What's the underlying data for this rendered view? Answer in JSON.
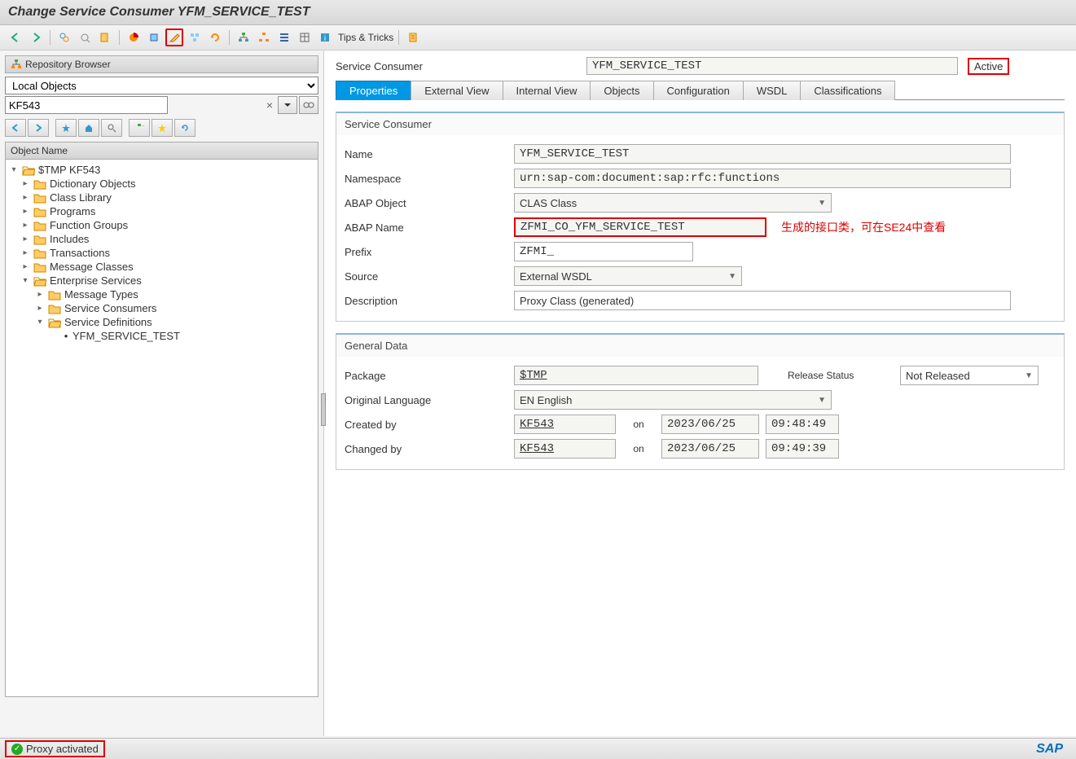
{
  "title": "Change Service Consumer YFM_SERVICE_TEST",
  "toolbar": {
    "tips_tricks": "Tips & Tricks"
  },
  "sidebar": {
    "browser_title": "Repository Browser",
    "scope": "Local Objects",
    "user": "KF543",
    "tree_header": "Object Name",
    "items": [
      {
        "label": "$TMP KF543",
        "open": true,
        "indent": 0,
        "toggle": "▾"
      },
      {
        "label": "Dictionary Objects",
        "indent": 1,
        "toggle": "▸"
      },
      {
        "label": "Class Library",
        "indent": 1,
        "toggle": "▸"
      },
      {
        "label": "Programs",
        "indent": 1,
        "toggle": "▸"
      },
      {
        "label": "Function Groups",
        "indent": 1,
        "toggle": "▸"
      },
      {
        "label": "Includes",
        "indent": 1,
        "toggle": "▸"
      },
      {
        "label": "Transactions",
        "indent": 1,
        "toggle": "▸"
      },
      {
        "label": "Message Classes",
        "indent": 1,
        "toggle": "▸"
      },
      {
        "label": "Enterprise Services",
        "open": true,
        "indent": 1,
        "toggle": "▾"
      },
      {
        "label": "Message Types",
        "indent": 2,
        "toggle": "▸"
      },
      {
        "label": "Service Consumers",
        "indent": 2,
        "toggle": "▸"
      },
      {
        "label": "Service Definitions",
        "open": true,
        "indent": 2,
        "toggle": "▾"
      },
      {
        "label": "YFM_SERVICE_TEST",
        "indent": 3,
        "leaf": true
      }
    ]
  },
  "header": {
    "label": "Service Consumer",
    "value": "YFM_SERVICE_TEST",
    "status": "Active"
  },
  "tabs": [
    "Properties",
    "External View",
    "Internal View",
    "Objects",
    "Configuration",
    "WSDL",
    "Classifications"
  ],
  "active_tab": 0,
  "group1": {
    "title": "Service Consumer",
    "name_label": "Name",
    "name_value": "YFM_SERVICE_TEST",
    "namespace_label": "Namespace",
    "namespace_value": "urn:sap-com:document:sap:rfc:functions",
    "abap_obj_label": "ABAP Object",
    "abap_obj_value": "CLAS Class",
    "abap_name_label": "ABAP Name",
    "abap_name_value": "ZFMI_CO_YFM_SERVICE_TEST",
    "abap_name_note": "生成的接口类，可在SE24中查看",
    "prefix_label": "Prefix",
    "prefix_value": "ZFMI_",
    "source_label": "Source",
    "source_value": "External WSDL",
    "desc_label": "Description",
    "desc_value": "Proxy Class (generated)"
  },
  "group2": {
    "title": "General Data",
    "package_label": "Package",
    "package_value": "$TMP",
    "release_label": "Release Status",
    "release_value": "Not Released",
    "lang_label": "Original Language",
    "lang_value": "EN English",
    "created_label": "Created by",
    "created_by": "KF543",
    "on_label": "on",
    "created_date": "2023/06/25",
    "created_time": "09:48:49",
    "changed_label": "Changed by",
    "changed_by": "KF543",
    "changed_date": "2023/06/25",
    "changed_time": "09:49:39"
  },
  "status_bar": {
    "message": "Proxy activated",
    "logo": "SAP"
  }
}
